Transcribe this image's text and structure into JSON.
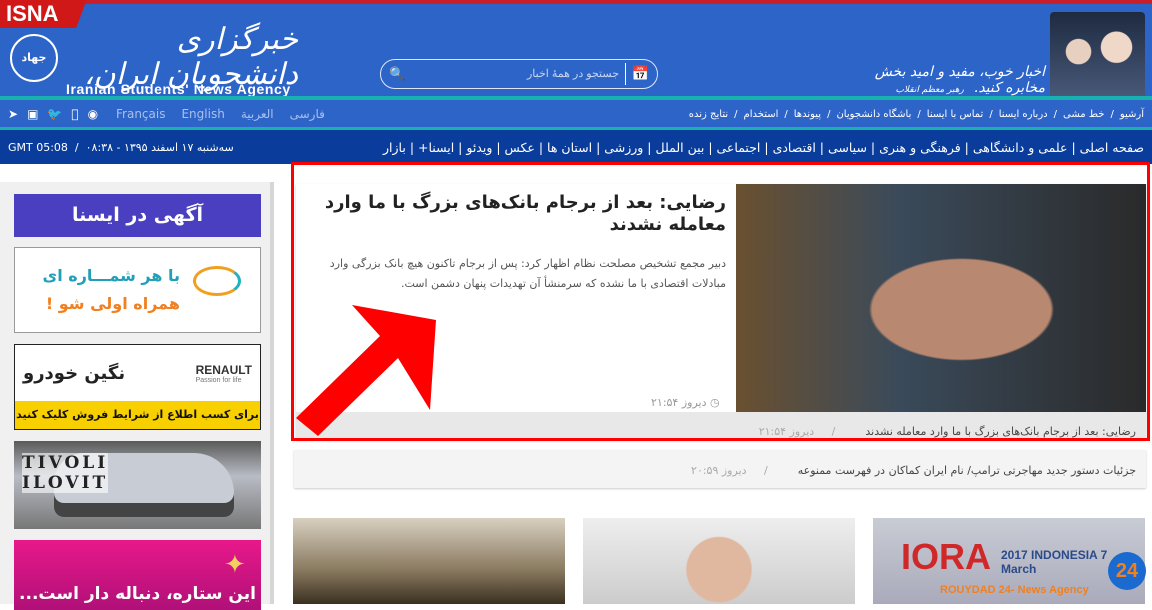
{
  "header": {
    "brand": "ISNA",
    "emblem": "جهاد",
    "logo_fa": "خبرگزاری دانشجویان ایران، ایسنا",
    "logo_en": "Iranian Students' News Agency",
    "search_placeholder": "جستجو در همهٔ اخبار",
    "motto": "اخبار خوب، مفید و امید بخش مخابره کنید.",
    "motto_attr": "رهبر معظم انقلاب"
  },
  "social_icons": [
    "telegram-icon",
    "instagram-icon",
    "twitter-icon",
    "apple-icon",
    "android-icon"
  ],
  "languages": [
    "Français",
    "English",
    "العربية",
    "فارسی"
  ],
  "top_links": [
    "آرشیو",
    "خط مشی",
    "درباره ایسنا",
    "تماس با ایسنا",
    "باشگاه دانشجویان",
    "پیوندها",
    "استخدام",
    "نتایج زنده"
  ],
  "datetime": {
    "gmt": "GMT 05:08",
    "local": "سه‌شنبه ۱۷ اسفند ۱۳۹۵ - ۰۸:۳۸"
  },
  "categories": [
    "صفحه اصلی",
    "علمی و دانشگاهی",
    "فرهنگی و هنری",
    "سیاسی",
    "اقتصادی",
    "اجتماعی",
    "بین الملل",
    "ورزشی",
    "استان ها",
    "عکس",
    "ویدئو",
    "ایسنا+",
    "بازار"
  ],
  "sidebar": {
    "heading": "آگهی در ایسنا",
    "ad1_line1": "با هر شمـــاره ای",
    "ad1_line2": "همراه اولی شو !",
    "ad2_brand": "RENAULT",
    "ad2_tag": "Passion for life",
    "ad2_dealer": "نگین خودرو",
    "ad2_cta": "برای کسب اطلاع از شرایط فروش کلیک کنید",
    "ad3_line1": "TIVOLI",
    "ad3_line2": "ILOVIT",
    "ad4_text": "این ستاره، دنباله دار است..."
  },
  "featured": {
    "title": "رضایی: بعد از برجام بانک‌های بزرگ با ما وارد معامله نشدند",
    "summary": "دبیر مجمع تشخیص مصلحت نظام اظهار کرد: پس از برجام تاکنون هیچ بانک بزرگی وارد مبادلات اقتصادی با ما نشده که سرمنشأ آن تهدیدات پنهان دشمن است.",
    "time": "دیروز ۲۱:۵۴"
  },
  "headlines": [
    {
      "title": "رضایی: بعد از برجام بانک‌های بزرگ با ما وارد معامله نشدند",
      "time": "دیروز ۲۱:۵۴"
    },
    {
      "title": "جزئیات دستور جدید مهاجرتی ترامپ/ نام ایران کماکان در فهرست ممنوعه",
      "time": "دیروز ۲۰:۵۹"
    }
  ],
  "cards": [
    {
      "text": ""
    },
    {
      "text": ""
    },
    {
      "text": "IORA",
      "sub": "2017 INDONESIA 7 March"
    }
  ],
  "watermark": "ROUYDAD 24- News Agency",
  "watermark_logo": "24",
  "colors": {
    "header": "#2d64c8",
    "nav": "#0a3c9c",
    "accent": "#19b0b0",
    "highlight": "#ff0000"
  }
}
